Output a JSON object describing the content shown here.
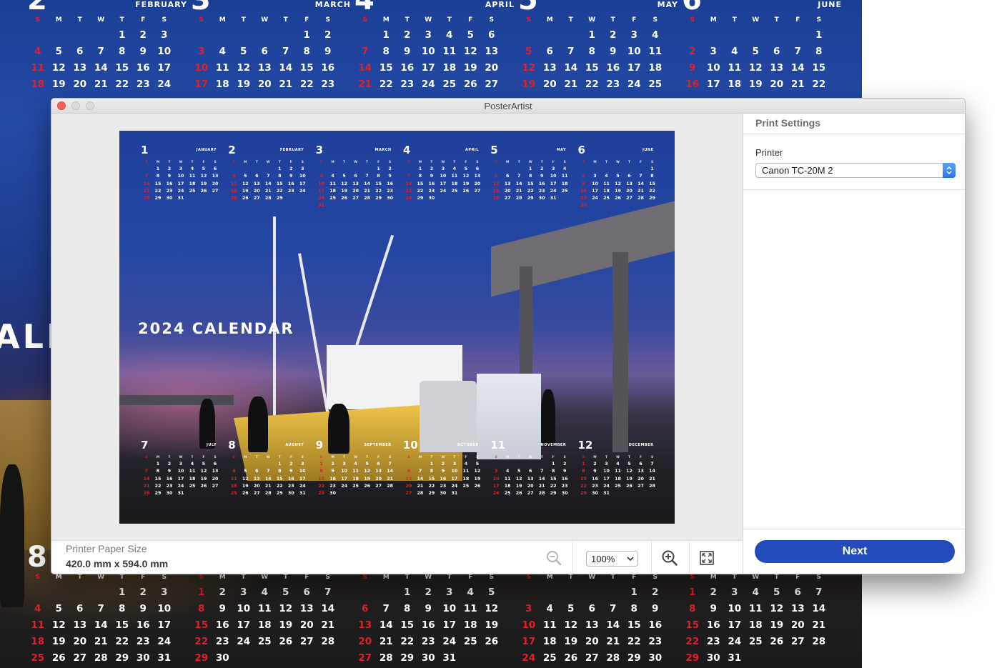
{
  "window": {
    "title": "PosterArtist"
  },
  "sidebar": {
    "title": "Print Settings",
    "printer_label": "Printer",
    "printer_value": "Canon TC-20M 2",
    "next_label": "Next"
  },
  "bottom_bar": {
    "paper_size_label": "Printer Paper Size",
    "paper_size_value": "420.0 mm x 594.0 mm",
    "zoom_value": "100%",
    "icons": [
      "zoom-out-icon",
      "zoom-in-icon",
      "fit-to-window-icon"
    ]
  },
  "poster": {
    "title": "2024 CALENDAR",
    "weekday_letters": [
      "S",
      "M",
      "T",
      "W",
      "T",
      "F",
      "S"
    ],
    "months": [
      {
        "number": "1",
        "name": "JANUARY"
      },
      {
        "number": "2",
        "name": "FEBRUARY"
      },
      {
        "number": "3",
        "name": "MARCH"
      },
      {
        "number": "4",
        "name": "APRIL"
      },
      {
        "number": "5",
        "name": "MAY"
      },
      {
        "number": "6",
        "name": "JUNE"
      },
      {
        "number": "7",
        "name": "JULY"
      },
      {
        "number": "8",
        "name": "AUGUST"
      },
      {
        "number": "9",
        "name": "SEPTEMBER"
      },
      {
        "number": "10",
        "name": "OCTOBER"
      },
      {
        "number": "11",
        "name": "NOVEMBER"
      },
      {
        "number": "12",
        "name": "DECEMBER"
      }
    ]
  },
  "background_poster": {
    "partial_title": "ALE",
    "top_months": [
      {
        "number": "2",
        "name": "FEBRUARY"
      },
      {
        "number": "3",
        "name": "MARCH"
      },
      {
        "number": "4",
        "name": "APRIL"
      },
      {
        "number": "5",
        "name": "MAY"
      },
      {
        "number": "6",
        "name": "JUNE"
      }
    ],
    "bottom_months": [
      {
        "number": "8"
      }
    ]
  },
  "colors": {
    "accent": "#234bbb",
    "sunday_red": "#e1202a",
    "close_button": "#fc5f57",
    "stepper_blue": "#2a74ec"
  }
}
